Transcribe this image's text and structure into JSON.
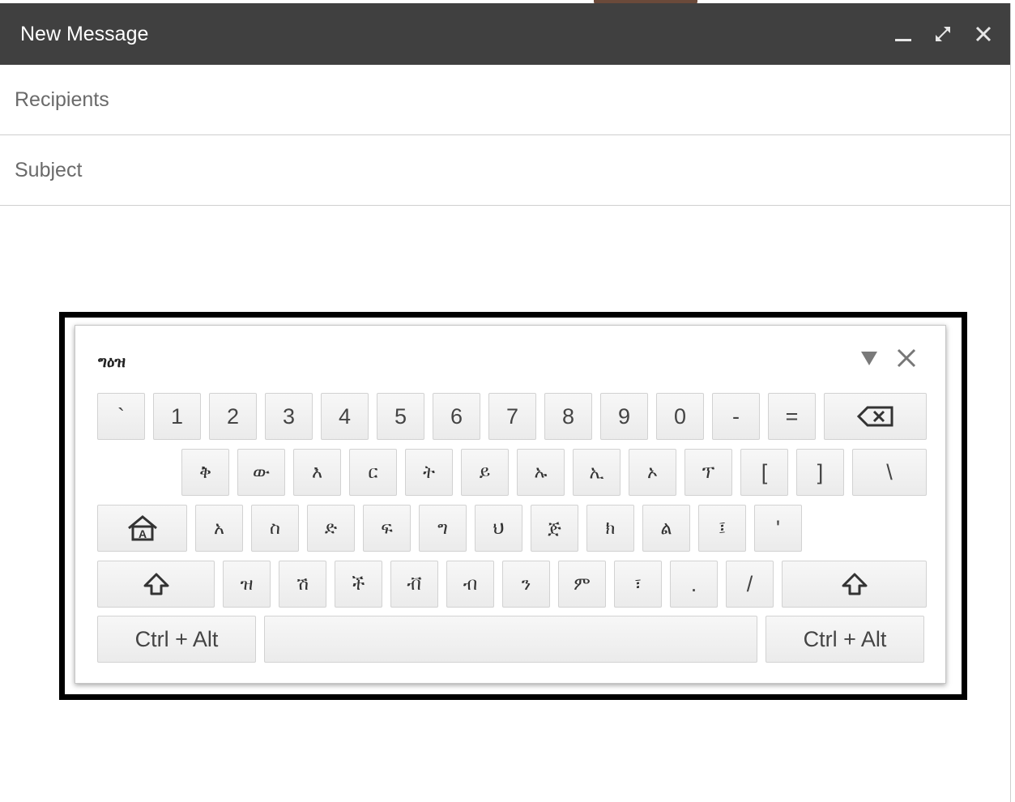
{
  "window": {
    "title": "New Message",
    "controls": [
      "minimize-icon",
      "expand-icon",
      "close-icon"
    ]
  },
  "fields": {
    "recipients_placeholder": "Recipients",
    "subject_placeholder": "Subject"
  },
  "keyboard": {
    "title": "ግዕዝ",
    "controls": [
      "dropdown-triangle-icon",
      "close-icon"
    ],
    "rows": [
      [
        "`",
        "1",
        "2",
        "3",
        "4",
        "5",
        "6",
        "7",
        "8",
        "9",
        "0",
        "-",
        "=",
        "backspace"
      ],
      [
        "ቅ",
        "ው",
        "እ",
        "ር",
        "ት",
        "ይ",
        "ኡ",
        "ኢ",
        "ኦ",
        "ፕ",
        "[",
        "]",
        "\\"
      ],
      [
        "home",
        "አ",
        "ስ",
        "ድ",
        "ፍ",
        "ግ",
        "ህ",
        "ጅ",
        "ክ",
        "ል",
        "፤",
        "'"
      ],
      [
        "shift",
        "ዝ",
        "ሽ",
        "ች",
        "ቭ",
        "ብ",
        "ን",
        "ም",
        "፣",
        ".",
        "/",
        "shift"
      ],
      [
        "Ctrl + Alt",
        "space",
        "Ctrl + Alt"
      ]
    ]
  }
}
